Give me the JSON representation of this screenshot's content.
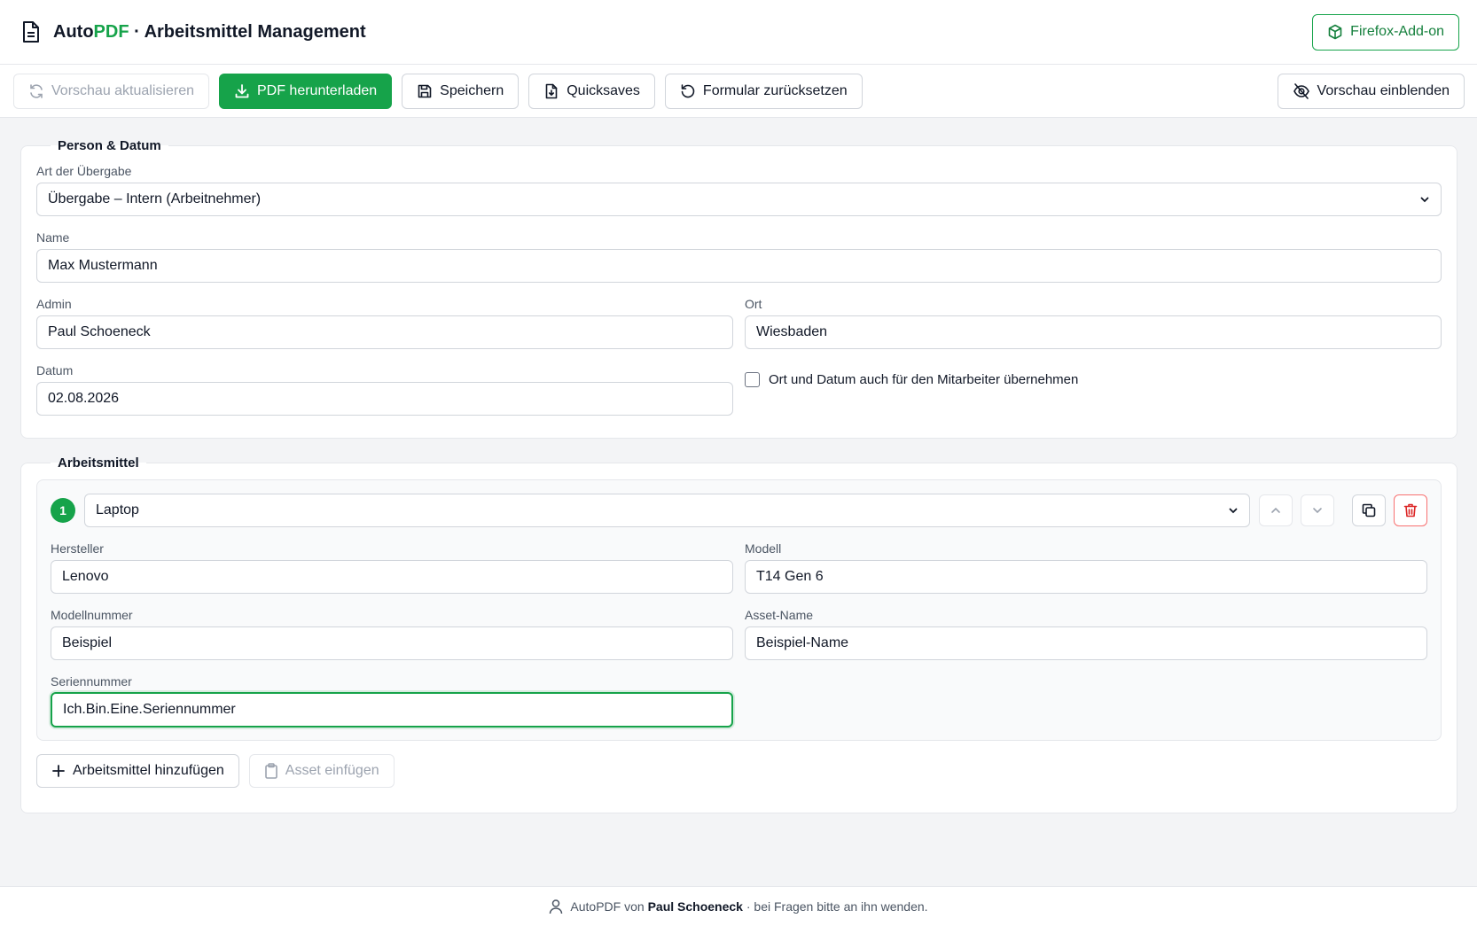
{
  "header": {
    "brand_prefix": "Auto",
    "brand_accent": "PDF",
    "brand_suffix": " · Arbeitsmittel Management",
    "addon_label": "Firefox-Add-on"
  },
  "toolbar": {
    "refresh_label": "Vorschau aktualisieren",
    "download_label": "PDF herunterladen",
    "save_label": "Speichern",
    "quicksaves_label": "Quicksaves",
    "reset_label": "Formular zurücksetzen",
    "preview_label": "Vorschau einblenden"
  },
  "person": {
    "legend": "Person & Datum",
    "type_label": "Art der Übergabe",
    "type_value": "Übergabe – Intern (Arbeitnehmer)",
    "name_label": "Name",
    "name_value": "Max Mustermann",
    "admin_label": "Admin",
    "admin_value": "Paul Schoeneck",
    "ort_label": "Ort",
    "ort_value": "Wiesbaden",
    "datum_label": "Datum",
    "datum_value": "02.08.2026",
    "checkbox_label": "Ort und Datum auch für den Mitarbeiter übernehmen"
  },
  "assets": {
    "legend": "Arbeitsmittel",
    "items": [
      {
        "number": "1",
        "type_value": "Laptop",
        "hersteller_label": "Hersteller",
        "hersteller_value": "Lenovo",
        "modell_label": "Modell",
        "modell_value": "T14 Gen 6",
        "modellnummer_label": "Modellnummer",
        "modellnummer_value": "Beispiel",
        "assetname_label": "Asset-Name",
        "assetname_value": "Beispiel-Name",
        "seriennummer_label": "Seriennummer",
        "seriennummer_value": "Ich.Bin.Eine.Seriennummer"
      }
    ],
    "add_label": "Arbeitsmittel hinzufügen",
    "paste_label": "Asset einfügen"
  },
  "footer": {
    "prefix": "AutoPDF von",
    "author": "Paul Schoeneck",
    "suffix": "· bei Fragen bitte an ihn wenden."
  },
  "colors": {
    "accent": "#16a34a",
    "danger": "#dc2626"
  }
}
